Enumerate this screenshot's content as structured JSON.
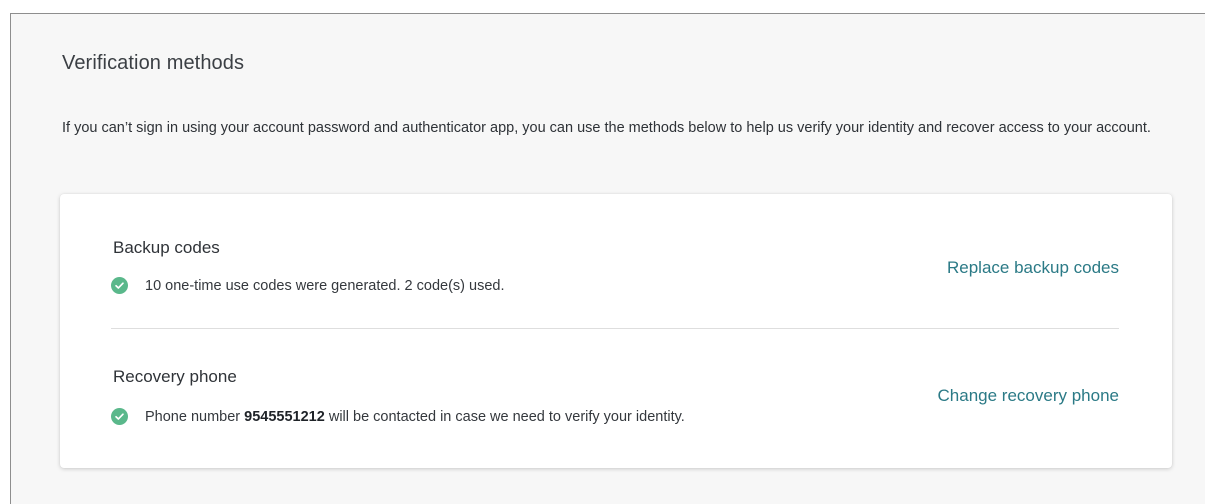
{
  "page": {
    "title": "Verification methods",
    "description": "If you can’t sign in using your account password and authenticator app, you can use the methods below to help us verify your identity and recover access to your account."
  },
  "backup_codes": {
    "title": "Backup codes",
    "status_text": "10 one-time use codes were generated. 2 code(s) used.",
    "action_label": "Replace backup codes"
  },
  "recovery_phone": {
    "title": "Recovery phone",
    "status_prefix": "Phone number ",
    "phone_number": "9545551212",
    "status_suffix": " will be contacted in case we need to verify your identity.",
    "action_label": "Change recovery phone"
  },
  "icons": {
    "status": "check-circle-icon"
  },
  "colors": {
    "success": "#5ab88b",
    "link": "#2b7a86",
    "background": "#f7f7f7",
    "card": "#ffffff"
  }
}
